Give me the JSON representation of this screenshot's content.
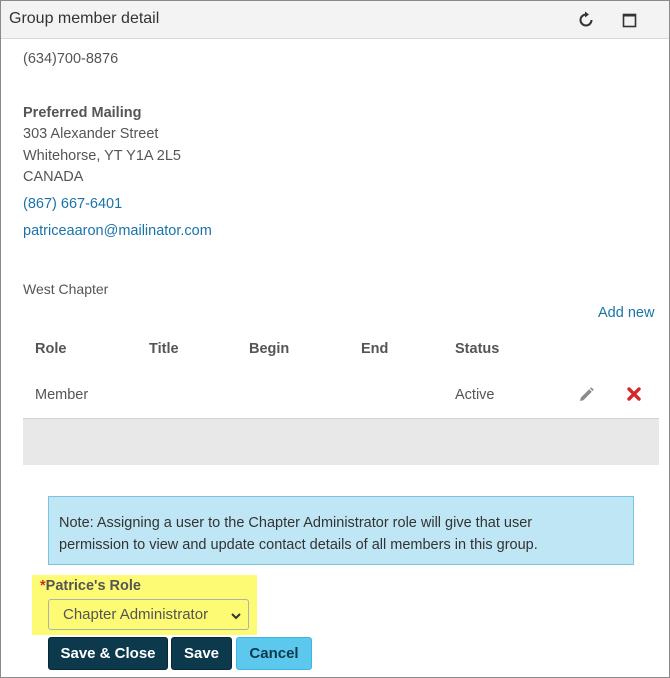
{
  "window": {
    "title": "Group member detail"
  },
  "contact": {
    "phone_top": "(634)700-8876",
    "address_heading": "Preferred Mailing",
    "address_line1": "303 Alexander Street",
    "address_line2": "Whitehorse, YT Y1A 2L5",
    "address_country": "CANADA",
    "phone_link": "(867) 667-6401",
    "email_link": "patriceaaron@mailinator.com"
  },
  "group": {
    "name": "West Chapter",
    "add_new_label": "Add new",
    "columns": [
      "Role",
      "Title",
      "Begin",
      "End",
      "Status"
    ],
    "rows": [
      {
        "role": "Member",
        "title": "",
        "begin": "",
        "end": "",
        "status": "Active"
      }
    ]
  },
  "note": {
    "line1": "Note: Assigning a user to the Chapter Administrator role will give that user",
    "line2": "permission to view and update contact details of all members in this group."
  },
  "role_field": {
    "required_mark": "*",
    "label": "Patrice's Role",
    "selected": "Chapter Administrator"
  },
  "buttons": {
    "save_close": "Save & Close",
    "save": "Save",
    "cancel": "Cancel"
  },
  "icons": {
    "refresh": "refresh-icon",
    "maximize": "maximize-icon",
    "edit": "pencil-icon",
    "delete": "delete-x-icon",
    "dropdown": "chevron-down-icon"
  },
  "colors": {
    "link": "#1a73a8",
    "dark_button": "#0c3a4c",
    "light_button": "#5cc8ee",
    "note_bg": "#bfe6f5",
    "highlight": "#fdfb73",
    "delete": "#d9262a"
  }
}
